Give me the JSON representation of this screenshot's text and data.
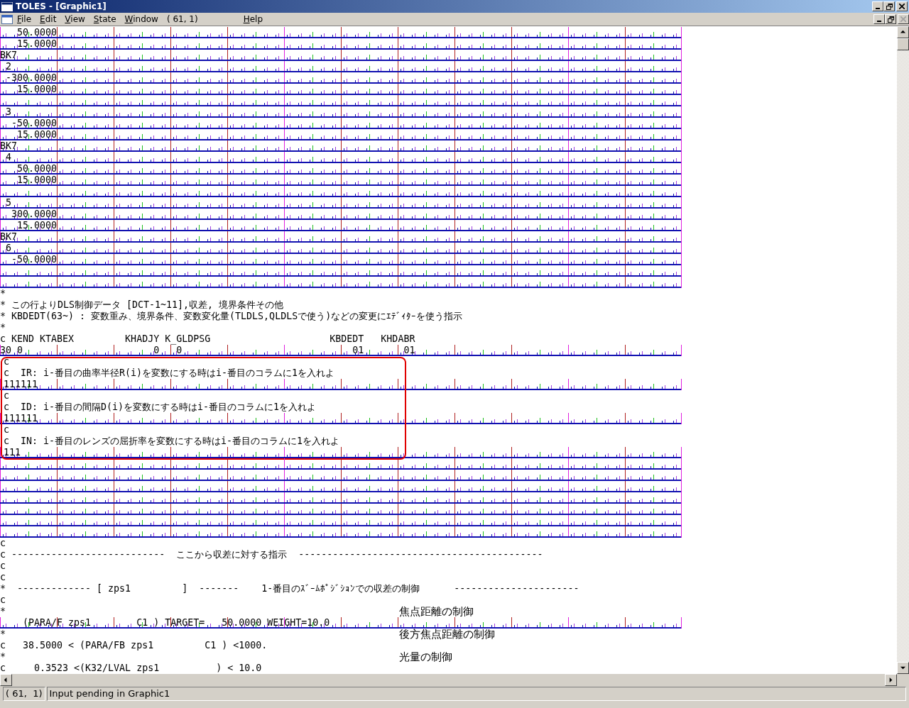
{
  "window": {
    "title": "TOLES - [Graphic1]"
  },
  "menu": [
    {
      "kind": "menu",
      "label": "File"
    },
    {
      "kind": "menu",
      "label": "Edit"
    },
    {
      "kind": "menu",
      "label": "View"
    },
    {
      "kind": "menu",
      "label": "State"
    },
    {
      "kind": "menu",
      "label": "Window"
    },
    {
      "kind": "info",
      "label": "( 61, 1)"
    },
    {
      "kind": "menu",
      "label": "Help"
    }
  ],
  "editor": {
    "lines": [
      {
        "kind": "ruled",
        "boxed": false,
        "text": "   50.0000"
      },
      {
        "kind": "ruled",
        "boxed": false,
        "text": "   15.0000"
      },
      {
        "kind": "ruled",
        "boxed": false,
        "text": "BK7"
      },
      {
        "kind": "ruled",
        "boxed": false,
        "text": " 2"
      },
      {
        "kind": "ruled",
        "boxed": false,
        "text": " -300.0000"
      },
      {
        "kind": "ruled",
        "boxed": false,
        "text": "   15.0000"
      },
      {
        "kind": "ruled",
        "boxed": false
      },
      {
        "kind": "ruled",
        "boxed": false,
        "text": " 3"
      },
      {
        "kind": "ruled",
        "boxed": false,
        "text": "  -50.0000"
      },
      {
        "kind": "ruled",
        "boxed": false,
        "text": "   15.0000"
      },
      {
        "kind": "ruled",
        "boxed": false,
        "text": "BK7"
      },
      {
        "kind": "ruled",
        "boxed": false,
        "text": " 4"
      },
      {
        "kind": "ruled",
        "boxed": false,
        "text": "   50.0000"
      },
      {
        "kind": "ruled",
        "boxed": false,
        "text": "   15.0000"
      },
      {
        "kind": "ruled",
        "boxed": false
      },
      {
        "kind": "ruled",
        "boxed": false,
        "text": " 5"
      },
      {
        "kind": "ruled",
        "boxed": false,
        "text": "  300.0000"
      },
      {
        "kind": "ruled",
        "boxed": false,
        "text": "   15.0000"
      },
      {
        "kind": "ruled",
        "boxed": false,
        "text": "BK7"
      },
      {
        "kind": "ruled",
        "boxed": false,
        "text": " 6"
      },
      {
        "kind": "ruled",
        "boxed": false,
        "text": "  -50.0000"
      },
      {
        "kind": "ruled",
        "boxed": false
      },
      {
        "kind": "ruled",
        "boxed": false
      },
      {
        "kind": "plain",
        "boxed": false,
        "text": "*"
      },
      {
        "kind": "plain",
        "boxed": false,
        "text": "* この行よりDLS制御データ [DCT-1~11],収差, 境界条件その他"
      },
      {
        "kind": "plain",
        "boxed": false,
        "text": "* KBDEDT(63~) : 変数重み、境界条件、変数変化量(TLDLS,QLDLSで使う)などの変更にｴﾃﾞｨﾀｰを使う指示"
      },
      {
        "kind": "plain",
        "boxed": false,
        "text": "*"
      },
      {
        "kind": "plain",
        "boxed": false,
        "text": "c KEND KTABEX         KHADJY K_GLDPSG                     KBDEDT   KHDABR"
      },
      {
        "kind": "ruled",
        "boxed": false,
        "text": "30 0                       0   0                              01       01"
      },
      {
        "kind": "plain",
        "boxed": true,
        "text": "c"
      },
      {
        "kind": "plain",
        "boxed": true,
        "text": "c  IR: i-番目の曲率半径R(i)を変数にする時はi-番目のコラムに1を入れよ"
      },
      {
        "kind": "ruled",
        "boxed": true,
        "text": "111111"
      },
      {
        "kind": "plain",
        "boxed": true,
        "text": "c"
      },
      {
        "kind": "plain",
        "boxed": true,
        "text": "c  ID: i-番目の間隔D(i)を変数にする時はi-番目のコラムに1を入れよ"
      },
      {
        "kind": "ruled",
        "boxed": true,
        "text": "111111"
      },
      {
        "kind": "plain",
        "boxed": true,
        "text": "c"
      },
      {
        "kind": "plain",
        "boxed": true,
        "text": "c  IN: i-番目のレンズの屈折率を変数にする時はi-番目のコラムに1を入れよ"
      },
      {
        "kind": "ruled",
        "boxed": true,
        "text": "111"
      },
      {
        "kind": "ruled",
        "boxed": false
      },
      {
        "kind": "ruled",
        "boxed": false
      },
      {
        "kind": "ruled",
        "boxed": false
      },
      {
        "kind": "ruled",
        "boxed": false
      },
      {
        "kind": "ruled",
        "boxed": false
      },
      {
        "kind": "ruled",
        "boxed": false
      },
      {
        "kind": "ruled",
        "boxed": false
      },
      {
        "kind": "plain",
        "boxed": false,
        "text": "c"
      },
      {
        "kind": "plain",
        "boxed": false,
        "text": "c ---------------------------  ここから収差に対する指示  -------------------------------------------"
      },
      {
        "kind": "plain",
        "boxed": false,
        "text": "c"
      },
      {
        "kind": "plain",
        "boxed": false,
        "text": "c"
      },
      {
        "kind": "plain",
        "boxed": false,
        "text": "*  ------------- [ zps1         ]  -------    1-番目のｽﾞｰﾑﾎﾟｼﾞｼｮﾝでの収差の制御      ----------------------"
      },
      {
        "kind": "plain",
        "boxed": false,
        "text": "c"
      },
      {
        "kind": "plain",
        "boxed": false,
        "text": "*",
        "note": "焦点距離の制御"
      },
      {
        "kind": "ruled",
        "boxed": false,
        "text": "    (PARA/F zps1        C1 ) TARGET=   50.0000 WEIGHT=10.0"
      },
      {
        "kind": "plain",
        "boxed": false,
        "text": "*",
        "note": "後方焦点距離の制御"
      },
      {
        "kind": "plain",
        "boxed": false,
        "text": "c   38.5000 < (PARA/FB zps1         C1 ) <1000."
      },
      {
        "kind": "plain",
        "boxed": false,
        "text": "*",
        "note": "光量の制御"
      },
      {
        "kind": "plain",
        "boxed": false,
        "text": "c     0.3523 <(K32/LVAL zps1          ) < 10.0"
      }
    ]
  },
  "status_bar": {
    "position": "( 61,  1)",
    "message": "Input pending in Graphic1"
  }
}
